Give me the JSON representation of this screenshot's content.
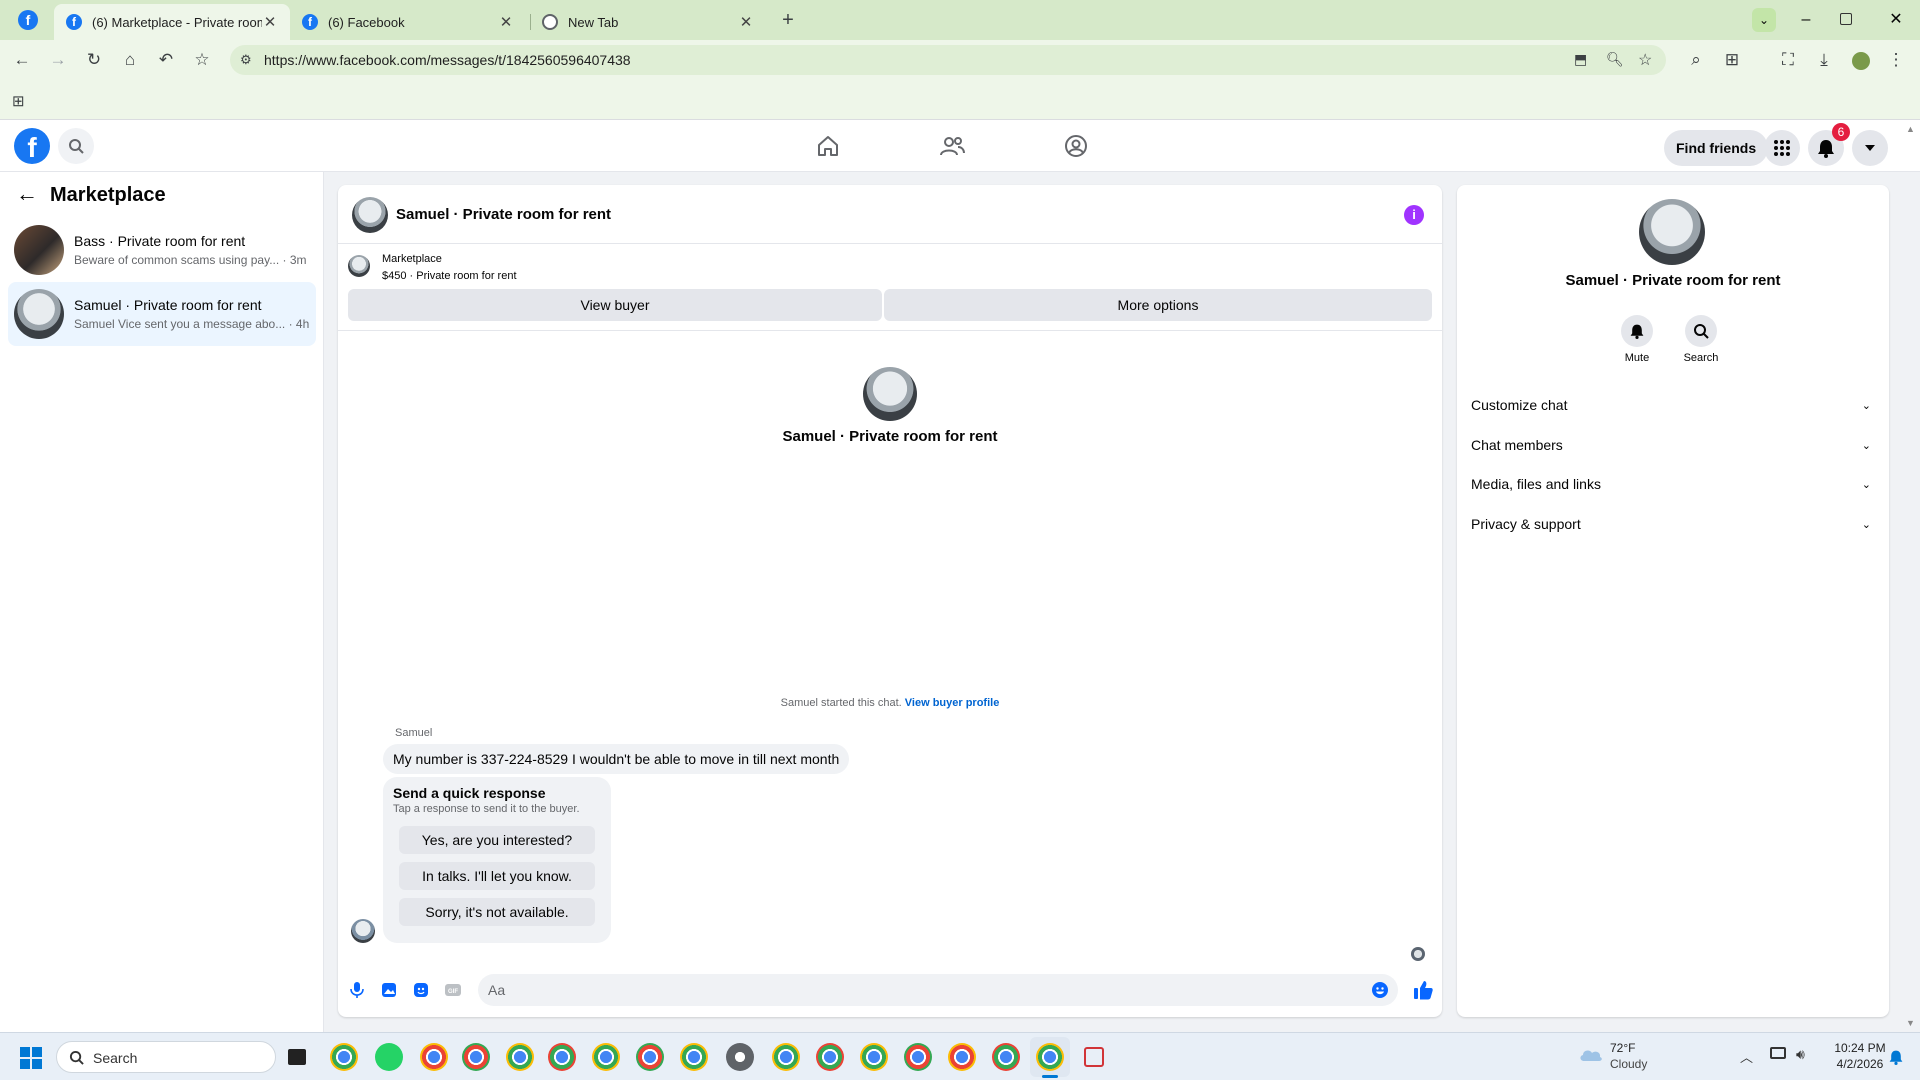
{
  "browser": {
    "tabs": [
      {
        "title": "(6) Marketplace - Private room",
        "active": true
      },
      {
        "title": "(6) Facebook",
        "active": false
      },
      {
        "title": "New Tab",
        "active": false
      }
    ],
    "url": "https://www.facebook.com/messages/t/1842560596407438",
    "new_tab_symbol": "+"
  },
  "fb_header": {
    "logo": "facebook-logo",
    "find_friends": "Find friends",
    "notification_count": "6",
    "colors": {
      "brand": "#1877f2",
      "badge": "#e41e3f"
    }
  },
  "sidebar": {
    "title": "Marketplace",
    "conversations": [
      {
        "name": "Bass · Private room for rent",
        "preview": "Beware of common scams using pay...",
        "time": "· 3m",
        "selected": false
      },
      {
        "name": "Samuel · Private room for rent",
        "preview": "Samuel Vice sent you a message abo...",
        "time": "· 4h",
        "selected": true
      }
    ]
  },
  "chat": {
    "header_title": "Samuel · Private room for rent",
    "listing_label": "Marketplace",
    "listing_title": "$450 · Private room for rent",
    "view_buyer": "View buyer",
    "more_options": "More options",
    "intro_name": "Samuel · Private room for rent",
    "started_text": "Samuel started this chat.",
    "view_buyer_profile": "View buyer profile",
    "sender_name": "Samuel",
    "message": "My number is 337-224-8529 I wouldn't be able to move in till next month",
    "quick_response": {
      "title": "Send a quick response",
      "subtitle": "Tap a response to send it to the buyer.",
      "options": [
        "Yes, are you interested?",
        "In talks. I'll let you know.",
        "Sorry, it's not available."
      ]
    },
    "composer_placeholder": "Aa"
  },
  "details": {
    "name": "Samuel · Private room for rent",
    "mute": "Mute",
    "search": "Search",
    "sections": [
      "Customize chat",
      "Chat members",
      "Media, files and links",
      "Privacy & support"
    ]
  },
  "taskbar": {
    "search_placeholder": "Search",
    "weather_temp": "72°F",
    "weather_desc": "Cloudy",
    "time": "10:24 PM",
    "date": "4/2/2026"
  }
}
